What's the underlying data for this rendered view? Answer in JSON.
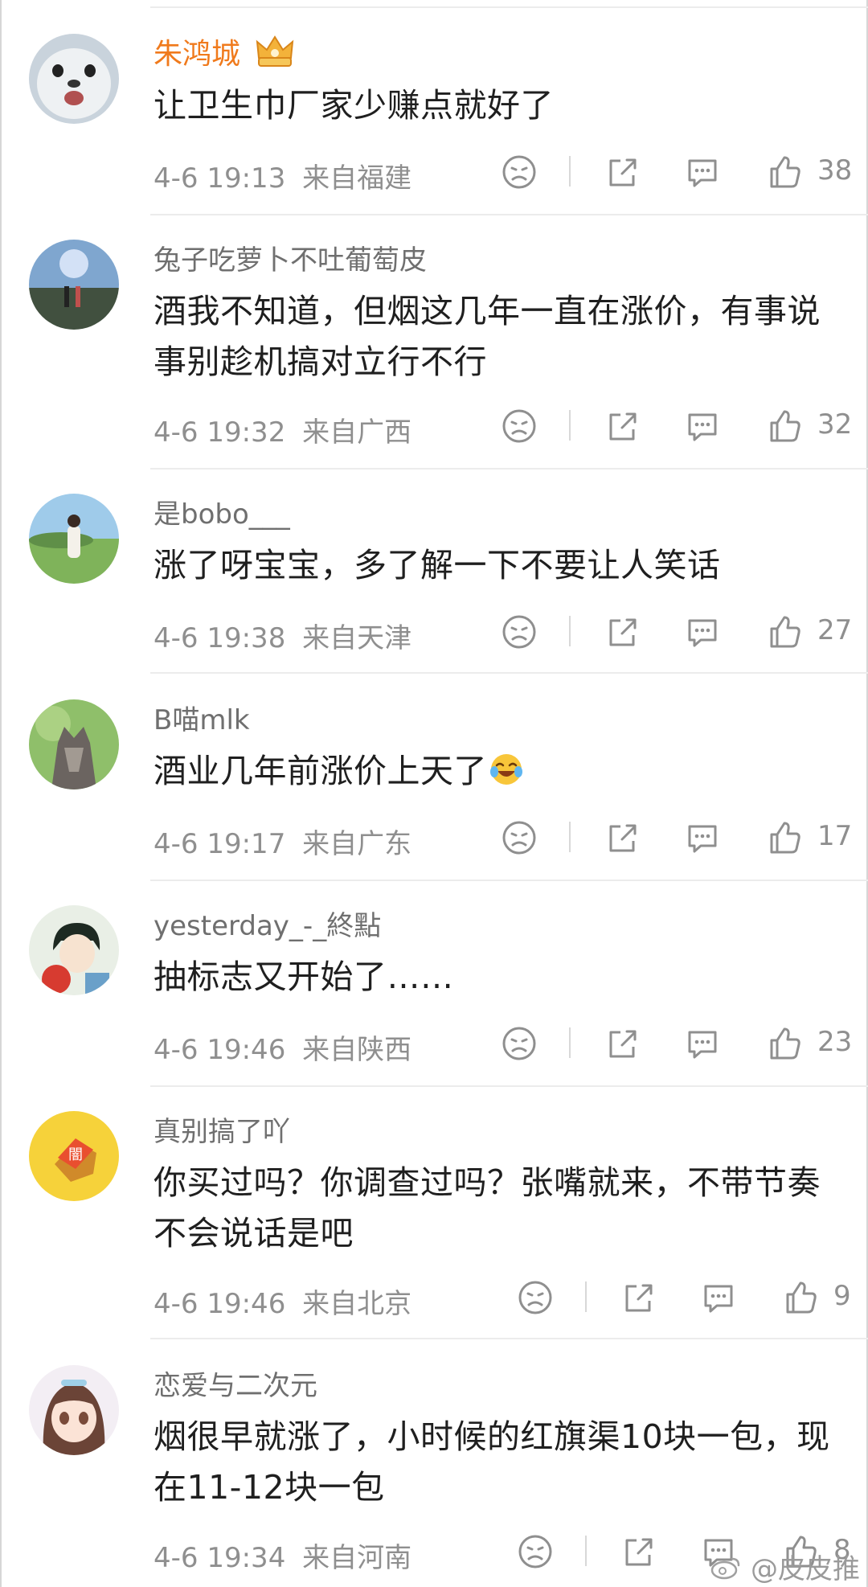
{
  "comments": [
    {
      "username": "朱鸿城",
      "vip": true,
      "text": "让卫生巾厂家少赚点就好了",
      "time": "4-6 19:13",
      "location": "来自福建",
      "likes": "38",
      "avatar": "seal"
    },
    {
      "username": "兔子吃萝卜不吐葡萄皮",
      "vip": false,
      "text": "酒我不知道，但烟这几年一直在涨价，有事说事别趁机搞对立行不行",
      "time": "4-6 19:32",
      "location": "来自广西",
      "likes": "32",
      "avatar": "sky"
    },
    {
      "username": "是bobo___",
      "vip": false,
      "text": "涨了呀宝宝，多了解一下不要让人笑话",
      "time": "4-6 19:38",
      "location": "来自天津",
      "likes": "27",
      "avatar": "meadow"
    },
    {
      "username": "B喵mlk",
      "vip": false,
      "text": "酒业几年前涨价上天了",
      "emoji": "laugh-cry",
      "time": "4-6 19:17",
      "location": "来自广东",
      "likes": "17",
      "avatar": "cat"
    },
    {
      "username": "yesterday_-_終點",
      "vip": false,
      "text": "抽标志又开始了……",
      "time": "4-6 19:46",
      "location": "来自陕西",
      "likes": "23",
      "avatar": "anime-boy"
    },
    {
      "username": "真别搞了吖",
      "vip": false,
      "text": "你买过吗？你调查过吗？张嘴就来，不带节奏不会说话是吧",
      "time": "4-6 19:46",
      "location": "来自北京",
      "likes": "9",
      "avatar": "yellow-logo"
    },
    {
      "username": "恋爱与二次元",
      "vip": false,
      "text": "烟很早就涨了，小时候的红旗渠10块一包，现在11-12块一包",
      "time": "4-6 19:34",
      "location": "来自河南",
      "likes": "8",
      "avatar": "anime-girl"
    }
  ],
  "watermark": "@皮皮推",
  "colors": {
    "vip_name": "#f07a1c",
    "text": "#1f1f1f",
    "meta": "#8f8f8f"
  },
  "icons": [
    "dislike-face-icon",
    "share-icon",
    "comment-icon",
    "thumbs-up-icon",
    "crown-badge-icon",
    "weibo-logo-icon"
  ]
}
